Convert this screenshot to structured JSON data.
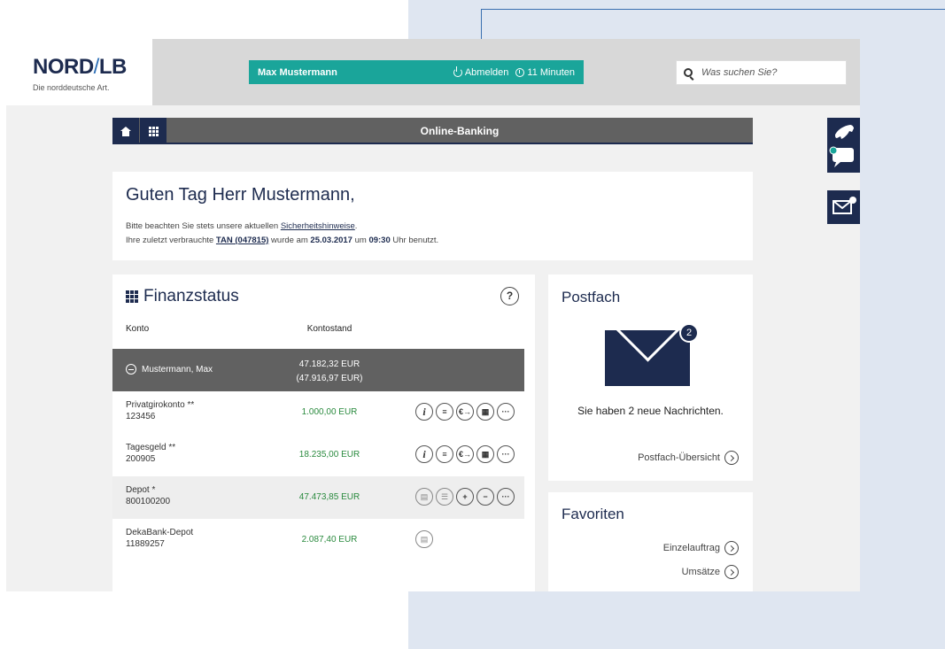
{
  "brand": {
    "name_a": "NORD",
    "name_b": "LB",
    "tagline": "Die norddeutsche Art."
  },
  "userbar": {
    "name": "Max Mustermann",
    "logout": "Abmelden",
    "timer": "11 Minuten"
  },
  "search": {
    "placeholder": "Was suchen Sie?"
  },
  "nav": {
    "title": "Online-Banking"
  },
  "greeting": {
    "title": "Guten Tag Herr Mustermann,",
    "line1_pre": "Bitte beachten Sie stets unsere aktuellen ",
    "line1_link": "Sicherheitshinweise",
    "line1_post": ".",
    "line2_pre": "Ihre zuletzt verbrauchte ",
    "tan": "TAN (047815)",
    "line2_mid": " wurde am ",
    "date": "25.03.2017",
    "line2_mid2": " um ",
    "time": "09:30",
    "line2_post": " Uhr benutzt."
  },
  "finanzstatus": {
    "title": "Finanzstatus",
    "help": "?",
    "col_konto": "Konto",
    "col_kontostand": "Kontostand",
    "owner": {
      "name": "Mustermann, Max",
      "total": "47.182,32 EUR",
      "total_alt": "(47.916,97 EUR)"
    },
    "accounts": [
      {
        "name": "Privatgirokonto **",
        "number": "123456",
        "balance": "1.000,00 EUR"
      },
      {
        "name": "Tagesgeld **",
        "number": "200905",
        "balance": "18.235,00 EUR"
      },
      {
        "name": "Depot *",
        "number": "800100200",
        "balance": "47.473,85 EUR"
      },
      {
        "name": "DekaBank-Depot",
        "number": "11889257",
        "balance": "2.087,40 EUR"
      }
    ]
  },
  "postfach": {
    "title": "Postfach",
    "badge": "2",
    "message": "Sie haben 2 neue Nachrichten.",
    "link": "Postfach-Übersicht"
  },
  "favoriten": {
    "title": "Favoriten",
    "link1": "Einzelauftrag",
    "link2": "Umsätze"
  }
}
